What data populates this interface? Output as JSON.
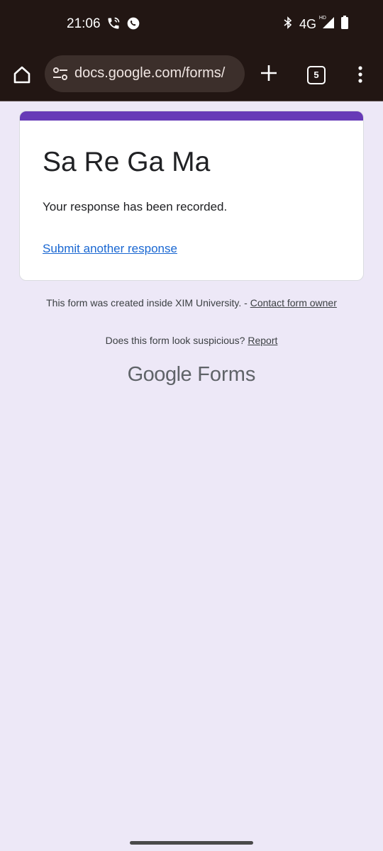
{
  "status_bar": {
    "time": "21:06",
    "network": "4G",
    "network_badge": "HD",
    "icons": [
      "wifi-calling-icon",
      "whatsapp-icon",
      "bluetooth-icon",
      "signal-icon",
      "battery-icon"
    ]
  },
  "browser": {
    "url": "docs.google.com/forms/",
    "tab_count": "5",
    "icons": [
      "home-icon",
      "tune-icon",
      "plus-icon",
      "more-vert-icon"
    ]
  },
  "form": {
    "title": "Sa Re Ga Ma",
    "confirmation": "Your response has been recorded.",
    "another_response_link": "Submit another response",
    "accent_color": "#673ab7"
  },
  "footer": {
    "created_text": "This form was created inside XIM University. - ",
    "contact_link": "Contact form owner",
    "suspicious_text": "Does this form look suspicious? ",
    "report_link": "Report",
    "brand_google": "Google",
    "brand_forms": "Forms"
  },
  "colors": {
    "page_background": "#ede8f7",
    "link": "#1967d2",
    "chrome": "#221613"
  }
}
